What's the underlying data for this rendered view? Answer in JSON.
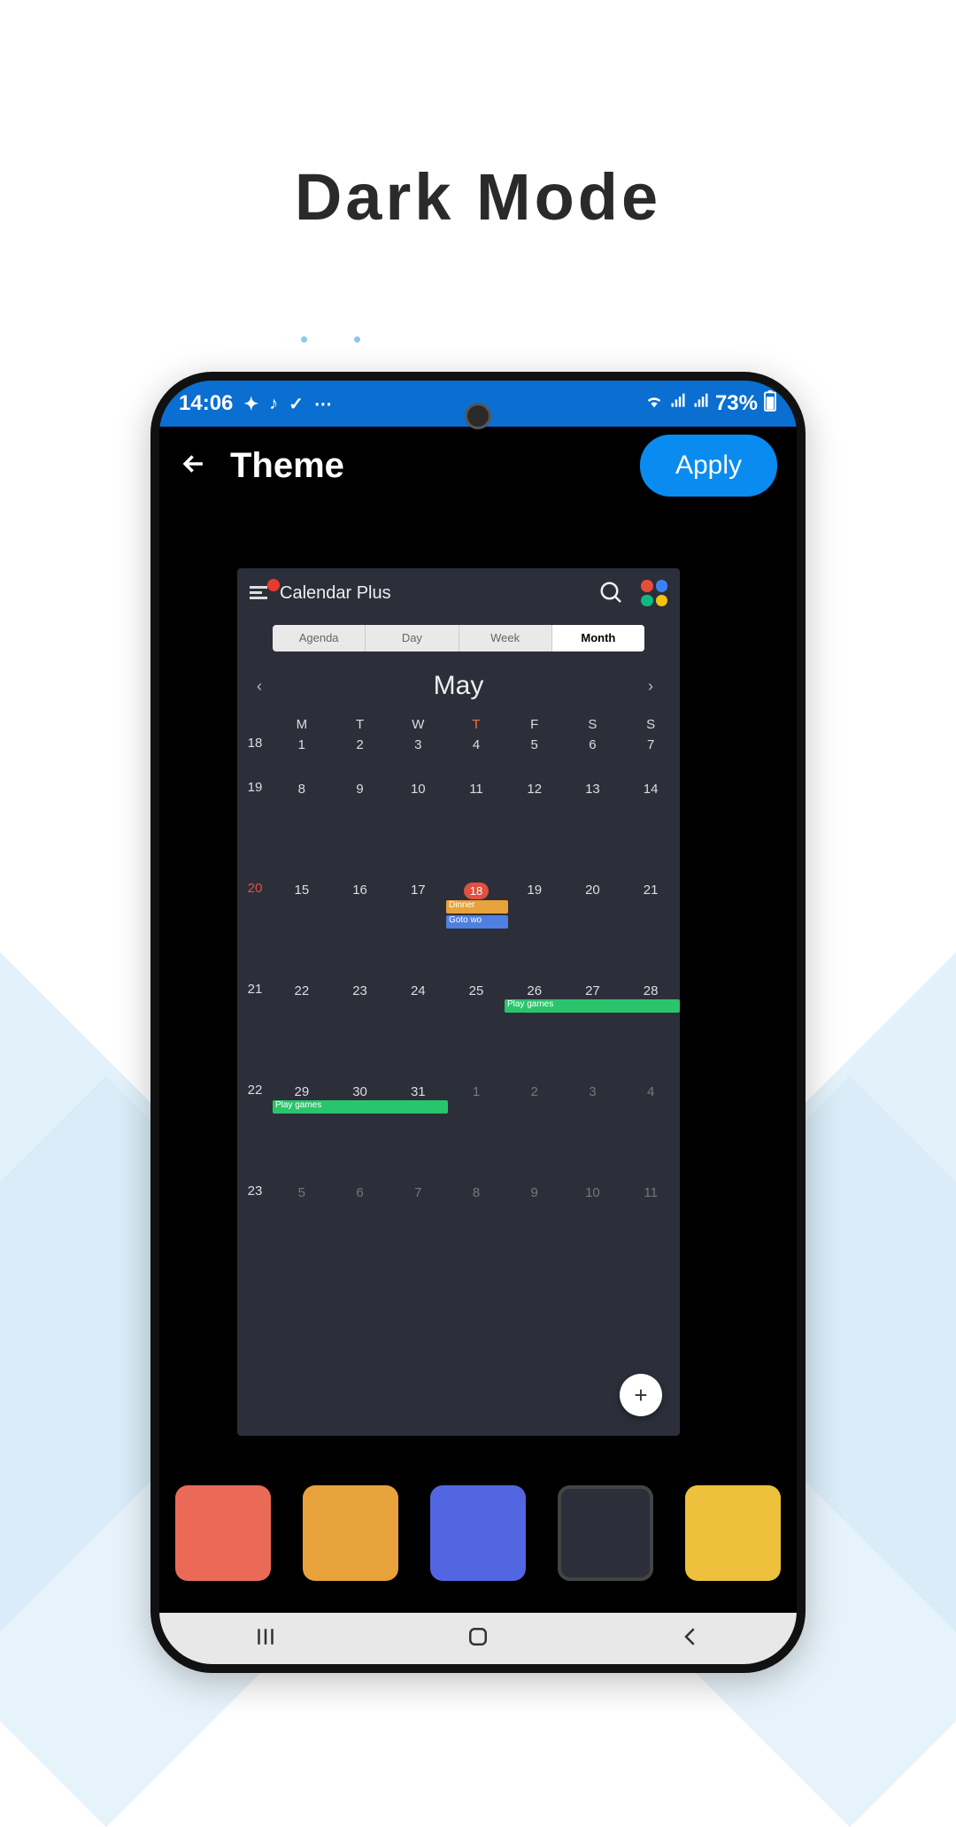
{
  "promo_title": "Dark Mode",
  "status": {
    "time": "14:06",
    "battery_text": "73%"
  },
  "header": {
    "title": "Theme",
    "apply_label": "Apply"
  },
  "preview": {
    "app_title": "Calendar Plus",
    "segments": {
      "agenda": "Agenda",
      "day": "Day",
      "week": "Week",
      "month": "Month",
      "active": "Month"
    },
    "month": "May",
    "day_headers": [
      "M",
      "T",
      "W",
      "T",
      "F",
      "S",
      "S"
    ],
    "weeks": [
      {
        "num": "18",
        "days": [
          "1",
          "2",
          "3",
          "4",
          "5",
          "6",
          "7"
        ]
      },
      {
        "num": "19",
        "days": [
          "8",
          "9",
          "10",
          "11",
          "12",
          "13",
          "14"
        ]
      },
      {
        "num": "20",
        "days": [
          "15",
          "16",
          "17",
          "18",
          "19",
          "20",
          "21"
        ]
      },
      {
        "num": "21",
        "days": [
          "22",
          "23",
          "24",
          "25",
          "26",
          "27",
          "28"
        ]
      },
      {
        "num": "22",
        "days": [
          "29",
          "30",
          "31",
          "1",
          "2",
          "3",
          "4"
        ]
      },
      {
        "num": "23",
        "days": [
          "5",
          "6",
          "7",
          "8",
          "9",
          "10",
          "11"
        ]
      }
    ],
    "today_day": "18",
    "events": {
      "dinner": "Dinner",
      "goto": "Goto wo",
      "play1": "Play games",
      "play2": "Play games"
    }
  },
  "swatches": [
    {
      "id": "red",
      "color": "#ea6a57"
    },
    {
      "id": "orange",
      "color": "#e8a23b"
    },
    {
      "id": "blue",
      "color": "#5166e0"
    },
    {
      "id": "dark",
      "color": "#2c2f3a"
    },
    {
      "id": "yellow",
      "color": "#eec13c"
    }
  ],
  "selected_swatch": "dark"
}
